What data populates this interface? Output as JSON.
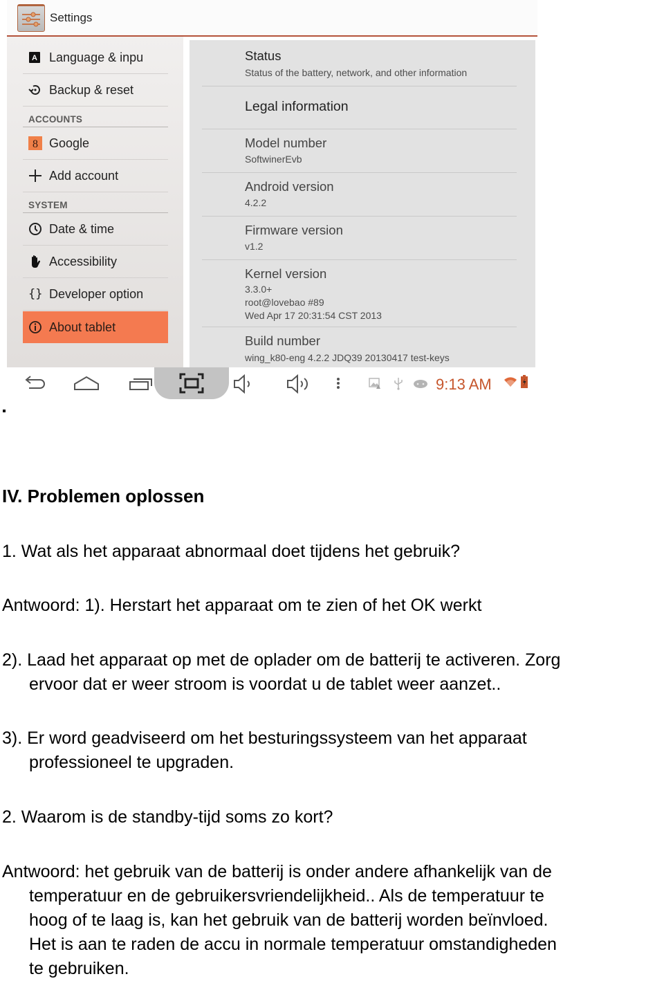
{
  "screenshot": {
    "app_title": "Settings",
    "left_menu": [
      {
        "type": "item",
        "label": "Language & inpu",
        "icon": "language-icon"
      },
      {
        "type": "item",
        "label": "Backup & reset",
        "icon": "backup-restore-icon"
      },
      {
        "type": "category",
        "label": "ACCOUNTS"
      },
      {
        "type": "item",
        "label": "Google",
        "icon": "google-account-icon"
      },
      {
        "type": "item",
        "label": "Add account",
        "icon": "plus-icon"
      },
      {
        "type": "category",
        "label": "SYSTEM"
      },
      {
        "type": "item",
        "label": "Date & time",
        "icon": "clock-icon"
      },
      {
        "type": "item",
        "label": "Accessibility",
        "icon": "hand-icon"
      },
      {
        "type": "item",
        "label": "Developer option",
        "icon": "braces-icon"
      },
      {
        "type": "item",
        "label": "About tablet",
        "icon": "info-icon",
        "selected": true
      }
    ],
    "about_items": [
      {
        "title": "Status",
        "summary": "Status of the battery, network, and other information"
      },
      {
        "title": "Legal information"
      },
      {
        "title": "Model number",
        "summary": "SoftwinerEvb"
      },
      {
        "title": "Android version",
        "summary": "4.2.2"
      },
      {
        "title": "Firmware version",
        "summary": "v1.2"
      },
      {
        "title": "Kernel version",
        "summary_lines": [
          "3.3.0+",
          "root@lovebao #89",
          "Wed Apr 17 20:31:54 CST 2013"
        ]
      },
      {
        "title": "Build number",
        "summary": "wing_k80-eng 4.2.2 JDQ39 20130417 test-keys"
      }
    ],
    "navbar": {
      "buttons": [
        "back",
        "home",
        "recent-apps",
        "screenshot",
        "volume-down",
        "volume-up",
        "menu"
      ],
      "notification_icons": [
        "gallery-icon",
        "usb-icon",
        "android-debug-icon"
      ],
      "clock": "9:13 AM",
      "status_icons": [
        "wifi-icon",
        "battery-charging-icon"
      ]
    },
    "colors": {
      "accent": "#f47a50",
      "clock": "#c6562c",
      "actionbar_line": "#b4523a"
    }
  },
  "stray_mark": ".",
  "document": {
    "heading": "IV. Problemen oplossen",
    "q1": "1. Wat als het apparaat abnormaal doet tijdens het gebruik?",
    "a1_1": "Antwoord: 1). Herstart het apparaat om te zien of het OK werkt",
    "a1_2_line1": "2). Laad het apparaat op met de oplader om de batterij te activeren. Zorg",
    "a1_2_line2": "ervoor dat er weer stroom is voordat u de tablet weer aanzet..",
    "a1_3_line1": "3). Er word geadviseerd om het besturingssysteem van het apparaat",
    "a1_3_line2": "professioneel te upgraden.",
    "q2": "2. Waarom is de standby-tijd soms zo kort?",
    "a2_line1": "Antwoord: het gebruik van de batterij is onder andere afhankelijk van de",
    "a2_line2": "temperatuur en de gebruikersvriendelijkheid.. Als de temperatuur te",
    "a2_line3": "hoog of te laag is, kan het gebruik van de batterij worden beïnvloed.",
    "a2_line4": "Het is aan te raden de accu in normale temperatuur omstandigheden",
    "a2_line5": "te gebruiken."
  }
}
